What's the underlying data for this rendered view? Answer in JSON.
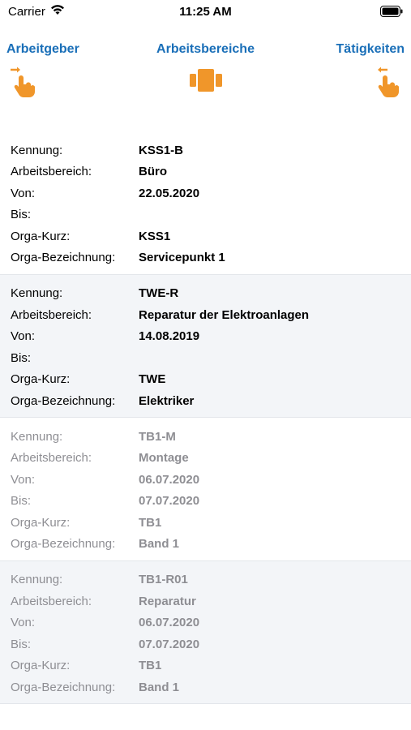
{
  "status_bar": {
    "carrier": "Carrier",
    "time": "11:25 AM"
  },
  "nav": {
    "left_label": "Arbeitgeber",
    "center_label": "Arbeitsbereiche",
    "right_label": "Tätigkeiten",
    "accent_color": "#1a6fb8",
    "icon_color": "#f0962a"
  },
  "field_labels": {
    "kennung": "Kennung:",
    "arbeitsbereich": "Arbeitsbereich:",
    "von": "Von:",
    "bis": "Bis:",
    "orga_kurz": "Orga-Kurz:",
    "orga_bezeichnung": "Orga-Bezeichnung:"
  },
  "records": [
    {
      "kennung": "KSS1-B",
      "arbeitsbereich": "Büro",
      "von": "22.05.2020",
      "bis": "",
      "orga_kurz": "KSS1",
      "orga_bezeichnung": "Servicepunkt 1"
    },
    {
      "kennung": "TWE-R",
      "arbeitsbereich": "Reparatur der Elektroanlagen",
      "von": "14.08.2019",
      "bis": "",
      "orga_kurz": "TWE",
      "orga_bezeichnung": "Elektriker"
    },
    {
      "kennung": "TB1-M",
      "arbeitsbereich": "Montage",
      "von": "06.07.2020",
      "bis": "07.07.2020",
      "orga_kurz": "TB1",
      "orga_bezeichnung": "Band 1"
    },
    {
      "kennung": "TB1-R01",
      "arbeitsbereich": "Reparatur",
      "von": "06.07.2020",
      "bis": "07.07.2020",
      "orga_kurz": "TB1",
      "orga_bezeichnung": "Band 1"
    }
  ]
}
